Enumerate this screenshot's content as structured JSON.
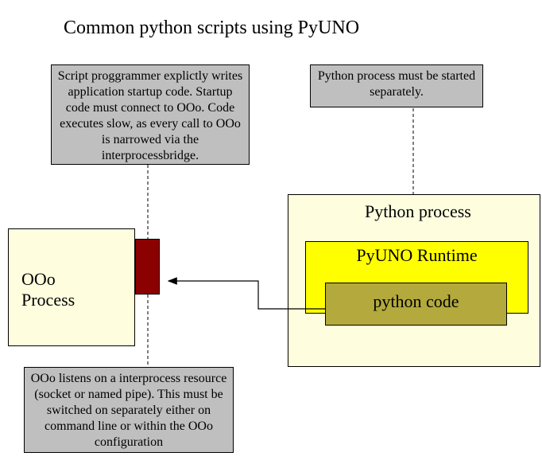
{
  "title": "Common python scripts using PyUNO",
  "notes": {
    "note_top_left": "Script proggrammer explictly writes application startup code. Startup code must connect to OOo. Code executes slow, as every call to OOo is narrowed via the interprocessbridge.",
    "note_top_right": "Python process must be started separately.",
    "note_bottom": "OOo listens on a interprocess resource (socket or named pipe). This must be switched on separately either on command line or within the OOo configuration"
  },
  "boxes": {
    "ooo_process_l1": "OOo",
    "ooo_process_l2": "Process",
    "python_process": "Python process",
    "pyuno_runtime": "PyUNO Runtime",
    "python_code": "python code"
  }
}
